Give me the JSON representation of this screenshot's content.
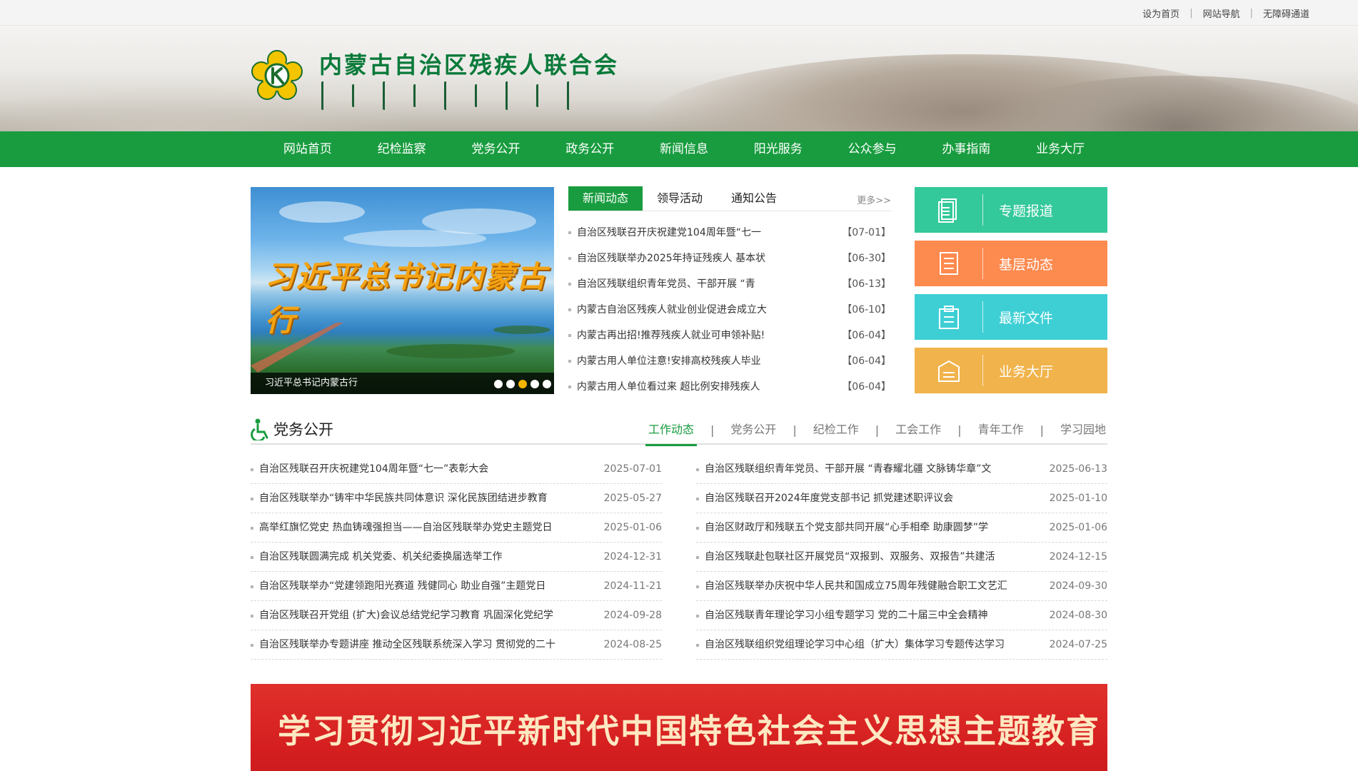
{
  "topbar": {
    "links": [
      "设为首页",
      "网站导航",
      "无障碍通道"
    ],
    "separator": "|"
  },
  "header": {
    "site_name": "内蒙古自治区残疾人联合会",
    "logo_color": "#f3c400",
    "title_color": "#0a7a3a"
  },
  "nav": {
    "items": [
      "网站首页",
      "纪检监察",
      "党务公开",
      "政务公开",
      "新闻信息",
      "阳光服务",
      "公众参与",
      "办事指南",
      "业务大厅"
    ],
    "bg_color": "#189c3f"
  },
  "slider": {
    "title": "习近平总书记内蒙古行",
    "caption": "习近平总书记内蒙古行",
    "dot_count": 5,
    "active_dot": 3
  },
  "news": {
    "tabs": [
      "新闻动态",
      "领导活动",
      "通知公告"
    ],
    "active_tab": 0,
    "more": "更多>>",
    "items": [
      {
        "title": "自治区残联召开庆祝建党104周年暨“七一",
        "date": "【07-01】"
      },
      {
        "title": "自治区残联举办2025年持证残疾人 基本状",
        "date": "【06-30】"
      },
      {
        "title": "自治区残联组织青年党员、干部开展 “青",
        "date": "【06-13】"
      },
      {
        "title": "内蒙古自治区残疾人就业创业促进会成立大",
        "date": "【06-10】"
      },
      {
        "title": "内蒙古再出招!推荐残疾人就业可申领补贴!",
        "date": "【06-04】"
      },
      {
        "title": "内蒙古用人单位注意!安排高校残疾人毕业",
        "date": "【06-04】"
      },
      {
        "title": "内蒙古用人单位看过来 超比例安排残疾人",
        "date": "【06-04】"
      }
    ]
  },
  "quick_links": [
    {
      "label": "专题报道",
      "color": "#34c99b",
      "icon": "document-icon"
    },
    {
      "label": "基层动态",
      "color": "#fd8a4f",
      "icon": "list-icon"
    },
    {
      "label": "最新文件",
      "color": "#3ecfd5",
      "icon": "clipboard-icon"
    },
    {
      "label": "业务大厅",
      "color": "#f1b34b",
      "icon": "folder-icon"
    }
  ],
  "party": {
    "title": "党务公开",
    "tabs": [
      "工作动态",
      "党务公开",
      "纪检工作",
      "工会工作",
      "青年工作",
      "学习园地"
    ],
    "active_tab": 0,
    "left": [
      {
        "title": "自治区残联召开庆祝建党104周年暨“七一”表彰大会",
        "date": "2025-07-01"
      },
      {
        "title": "自治区残联举办“铸牢中华民族共同体意识 深化民族团结进步教育",
        "date": "2025-05-27"
      },
      {
        "title": "高举红旗忆党史 热血铸魂强担当——自治区残联举办党史主题党日",
        "date": "2025-01-06"
      },
      {
        "title": "自治区残联圆满完成 机关党委、机关纪委换届选举工作",
        "date": "2024-12-31"
      },
      {
        "title": "自治区残联举办“党建领跑阳光赛道 残健同心 助业自强”主题党日",
        "date": "2024-11-21"
      },
      {
        "title": "自治区残联召开党组 (扩大)会议总结党纪学习教育 巩固深化党纪学",
        "date": "2024-09-28"
      },
      {
        "title": "自治区残联举办专题讲座 推动全区残联系统深入学习 贯彻党的二十",
        "date": "2024-08-25"
      }
    ],
    "right": [
      {
        "title": "自治区残联组织青年党员、干部开展 “青春耀北疆 文脉铸华章”文",
        "date": "2025-06-13"
      },
      {
        "title": "自治区残联召开2024年度党支部书记 抓党建述职评议会",
        "date": "2025-01-10"
      },
      {
        "title": "自治区财政厅和残联五个党支部共同开展“心手相牵 助康圆梦”学",
        "date": "2025-01-06"
      },
      {
        "title": "自治区残联赴包联社区开展党员“双报到、双服务、双报告”共建活",
        "date": "2024-12-15"
      },
      {
        "title": "自治区残联举办庆祝中华人民共和国成立75周年残健融合职工文艺汇",
        "date": "2024-09-30"
      },
      {
        "title": "自治区残联青年理论学习小组专题学习 党的二十届三中全会精神",
        "date": "2024-08-30"
      },
      {
        "title": "自治区残联组织党组理论学习中心组（扩大）集体学习专题传达学习",
        "date": "2024-07-25"
      }
    ]
  },
  "bottom_banner": {
    "text": "学习贯彻习近平新时代中国特色社会主义思想主题教育",
    "bg_color": "#d51f20"
  }
}
